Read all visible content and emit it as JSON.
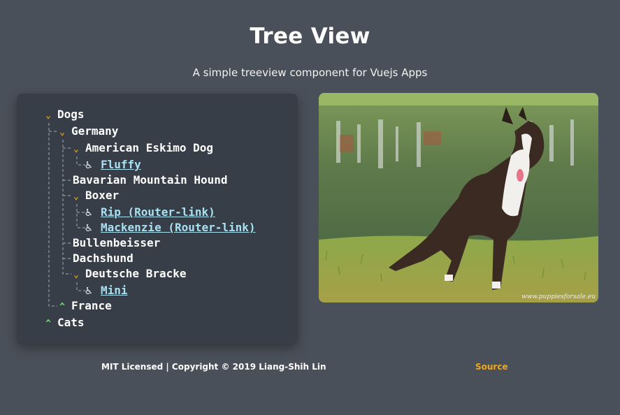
{
  "header": {
    "title": "Tree View",
    "subtitle": "A simple treeview component for Vuejs Apps"
  },
  "tree": {
    "dogs": "Dogs",
    "germany": "Germany",
    "american_eskimo_dog": "American Eskimo Dog",
    "fluffy": "Fluffy",
    "bavarian_mountain_hound": "Bavarian Mountain Hound",
    "boxer": "Boxer",
    "rip": "Rip (Router-link)",
    "mackenzie": "Mackenzie (Router-link)",
    "bullenbeisser": "Bullenbeisser",
    "dachshund": "Dachshund",
    "deutsche_bracke": "Deutsche Bracke",
    "mini": "Mini",
    "france": "France",
    "cats": "Cats"
  },
  "icons": {
    "expanded": "chevron-down-icon",
    "collapsed": "chevron-up-icon",
    "leaf": "wheelchair-icon"
  },
  "colors": {
    "background": "#4a5059",
    "panel": "#373e47",
    "expanded_chevron": "#f0a81c",
    "collapsed_chevron": "#6ee06e",
    "link": "#a9e0f2",
    "source_link": "#f0a81c"
  },
  "photo": {
    "watermark": "www.puppiesforsale.eu"
  },
  "footer": {
    "license": "MIT Licensed | Copyright © 2019 Liang-Shih Lin",
    "source": "Source"
  }
}
